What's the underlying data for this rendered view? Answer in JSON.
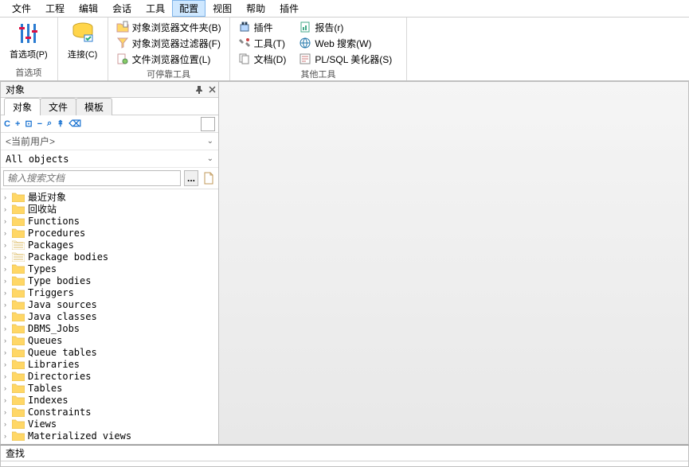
{
  "menu": {
    "items": [
      "文件",
      "工程",
      "编辑",
      "会话",
      "工具",
      "配置",
      "视图",
      "帮助",
      "插件"
    ],
    "active_index": 5
  },
  "ribbon": {
    "groups": [
      {
        "label": "首选项",
        "big": [
          {
            "label": "首选项(P)",
            "icon": "sliders"
          }
        ]
      },
      {
        "label": "",
        "big": [
          {
            "label": "连接(C)",
            "icon": "conn"
          }
        ]
      },
      {
        "label": "可停靠工具",
        "small": [
          {
            "label": "对象浏览器文件夹(B)",
            "icon": "folder-doc"
          },
          {
            "label": "对象浏览器过滤器(F)",
            "icon": "filter-doc"
          },
          {
            "label": "文件浏览器位置(L)",
            "icon": "file-loc"
          }
        ]
      },
      {
        "label": "其他工具",
        "small_cols": [
          [
            {
              "label": "插件",
              "icon": "plugin"
            },
            {
              "label": "工具(T)",
              "icon": "tools"
            },
            {
              "label": "文档(D)",
              "icon": "docs"
            }
          ],
          [
            {
              "label": "报告(r)",
              "icon": "report"
            },
            {
              "label": "Web 搜索(W)",
              "icon": "web"
            },
            {
              "label": "PL/SQL 美化器(S)",
              "icon": "beautify"
            }
          ]
        ]
      }
    ]
  },
  "sidebar": {
    "title": "对象",
    "tabs": [
      "对象",
      "文件",
      "模板"
    ],
    "active_tab": 0,
    "toolbar": [
      "C",
      "+",
      "⊡",
      "−",
      "⌕",
      "↟",
      "⌫"
    ],
    "user_dropdown": "<当前用户>",
    "filter_dropdown": "All objects",
    "search_placeholder": "输入搜索文档",
    "search_btn": "...",
    "tree": [
      "最近对象",
      "回收站",
      "Functions",
      "Procedures",
      "Packages",
      "Package bodies",
      "Types",
      "Type bodies",
      "Triggers",
      "Java sources",
      "Java classes",
      "DBMS_Jobs",
      "Queues",
      "Queue tables",
      "Libraries",
      "Directories",
      "Tables",
      "Indexes",
      "Constraints",
      "Views",
      "Materialized views"
    ]
  },
  "find": {
    "title": "查找"
  }
}
